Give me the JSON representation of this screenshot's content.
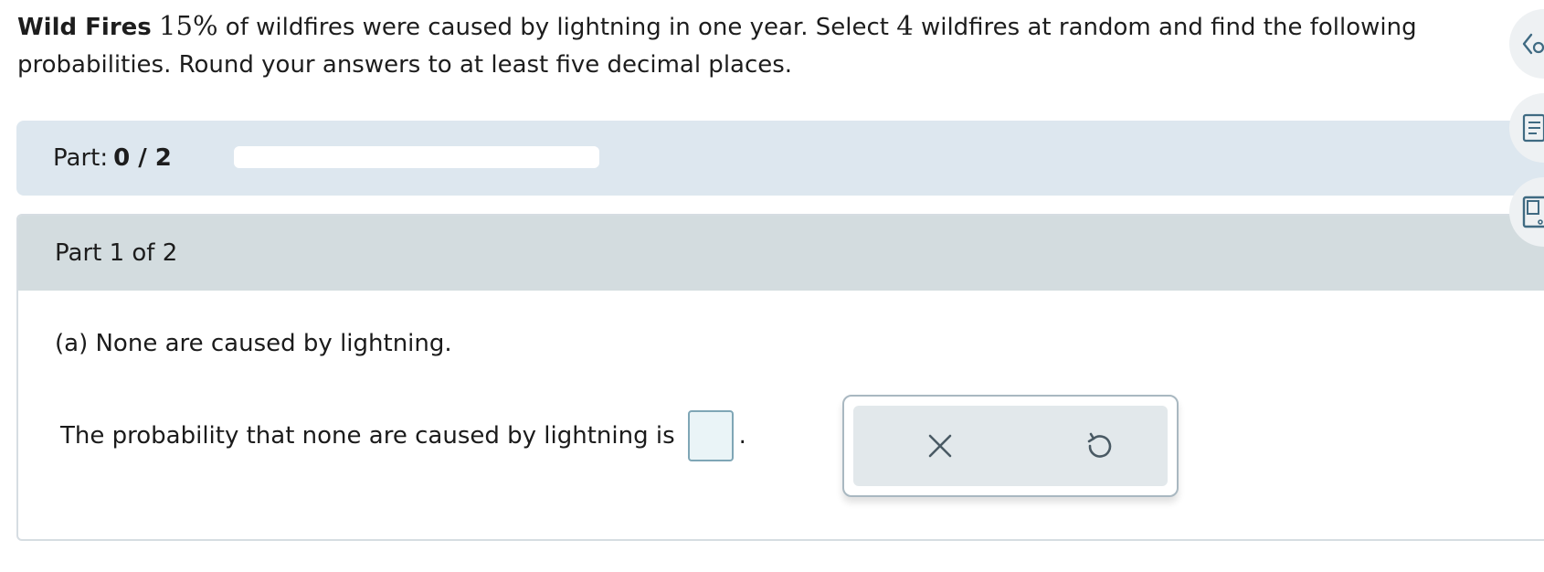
{
  "problem": {
    "title": "Wild Fires",
    "percent": "15%",
    "text_a": " of wildfires were caused by lightning in one year. Select ",
    "count": "4",
    "text_b": " wildfires at random and find the following probabilities. Round your answers to at least five decimal places."
  },
  "progress": {
    "label": "Part:",
    "value": "0 / 2",
    "fraction": 0
  },
  "part": {
    "header": "Part 1 of 2",
    "question": "(a) None are caused by lightning.",
    "answer_prefix": "The probability that none are caused by lightning is",
    "answer_suffix": ".",
    "answer_value": ""
  },
  "tools": {
    "clear_icon": "x-icon",
    "undo_icon": "undo-icon"
  },
  "side_icons": [
    "eraser-icon",
    "notes-icon",
    "calculator-icon"
  ]
}
